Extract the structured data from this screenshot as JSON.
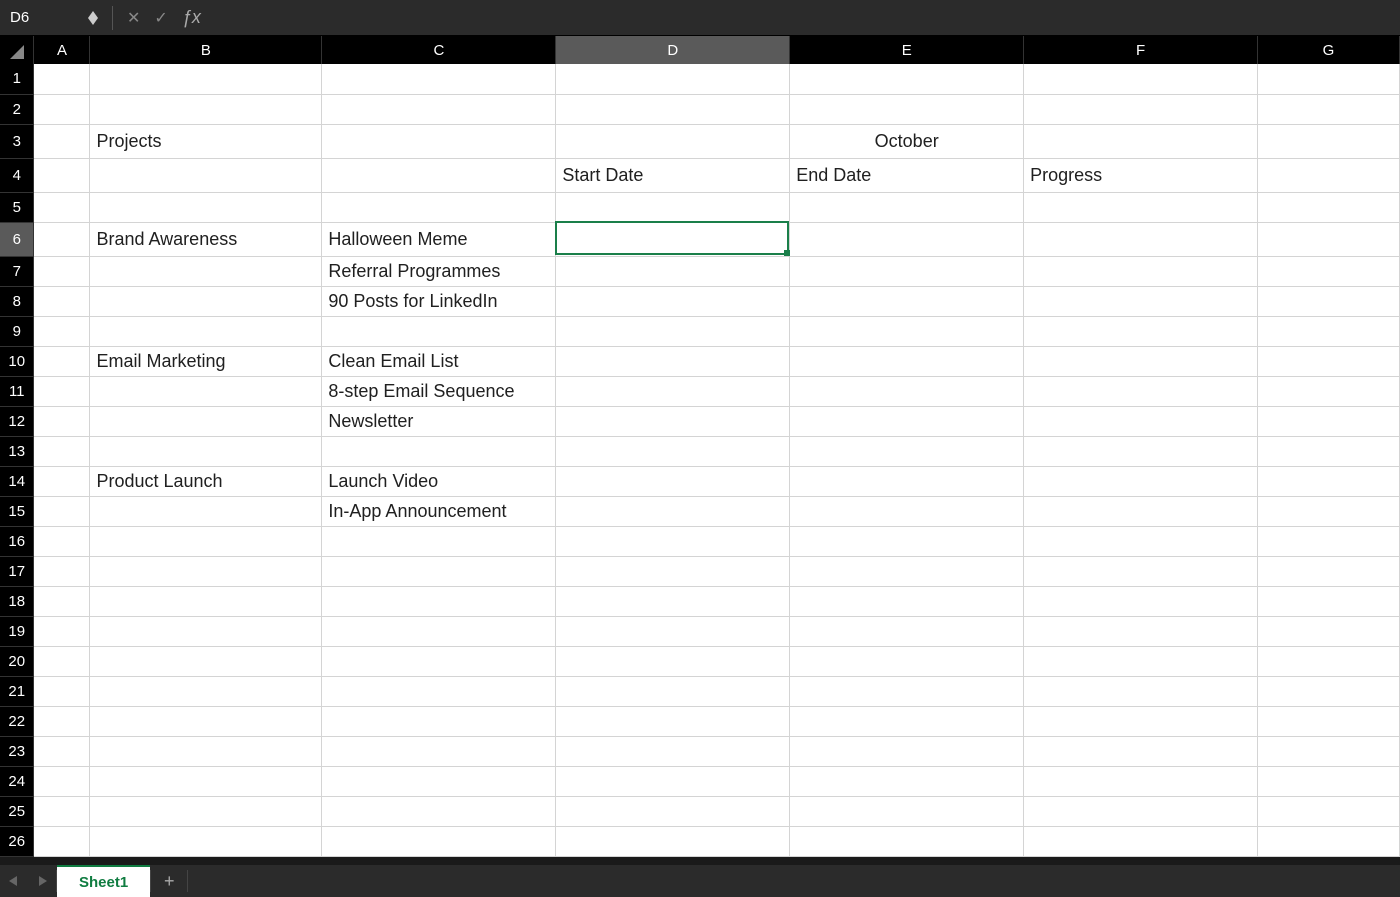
{
  "formula_bar": {
    "name_box": "D6",
    "fx_label": "ƒx",
    "value": ""
  },
  "selection": {
    "cell": "D6",
    "col_index": 4,
    "row_index": 6
  },
  "columns": [
    "A",
    "B",
    "C",
    "D",
    "E",
    "F",
    "G"
  ],
  "rows": [
    1,
    2,
    3,
    4,
    5,
    6,
    7,
    8,
    9,
    10,
    11,
    12,
    13,
    14,
    15,
    16,
    17,
    18,
    19,
    20,
    21,
    22,
    23,
    24,
    25,
    26
  ],
  "cells": {
    "B3": "Projects",
    "E3": "October",
    "D4": "Start Date",
    "E4": "End Date",
    "F4": "Progress",
    "B6": "Brand Awareness",
    "C6": "Halloween Meme",
    "C7": "Referral Programmes",
    "C8": "90 Posts for LinkedIn",
    "B10": "Email Marketing",
    "C10": "Clean Email List",
    "C11": "8-step Email Sequence",
    "C12": "Newsletter",
    "B14": "Product Launch",
    "C14": "Launch Video",
    "C15": "In-App Announcement"
  },
  "tabs": {
    "active": "Sheet1"
  }
}
